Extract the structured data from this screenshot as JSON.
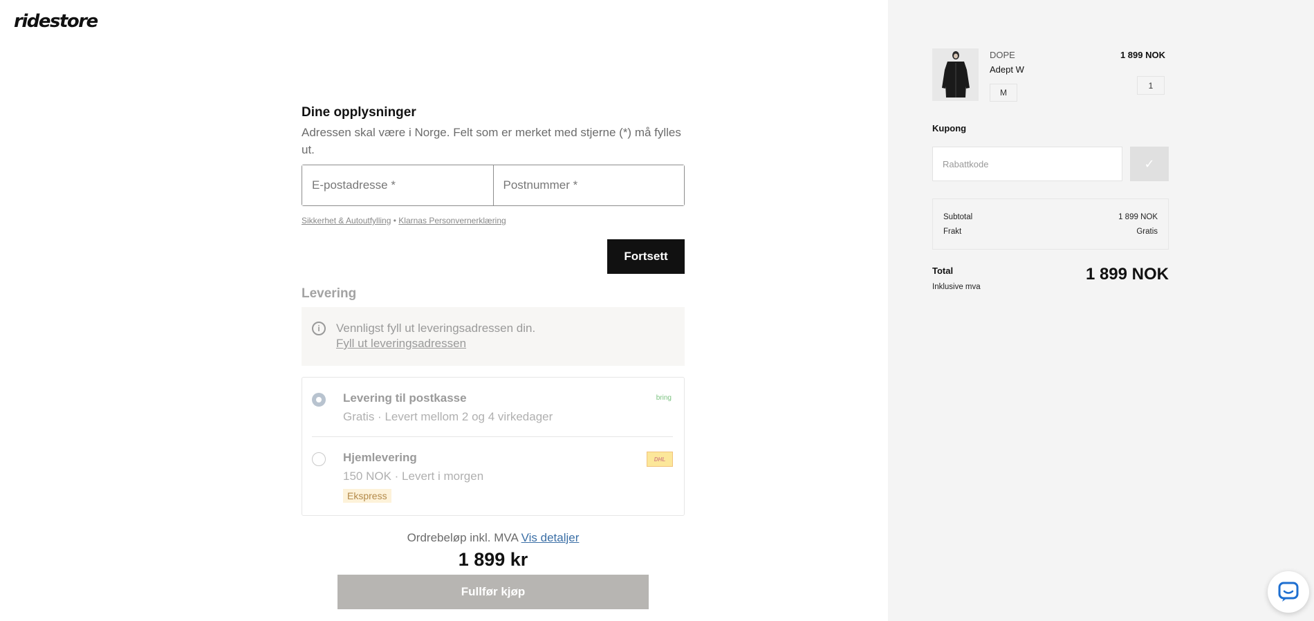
{
  "brand": {
    "logo": "ridestore"
  },
  "contact": {
    "title": "Dine opplysninger",
    "subtitle": "Adressen skal være i Norge. Felt som er merket med stjerne (*) må fylles ut.",
    "email_placeholder": "E-postadresse *",
    "postal_placeholder": "Postnummer *",
    "link_security": "Sikkerhet & Autoutfylling",
    "link_separator": "•",
    "link_privacy": "Klarnas Personvernerklæring",
    "continue_label": "Fortsett"
  },
  "delivery": {
    "title": "Levering",
    "info_text": "Vennligst fyll ut leveringsadressen din.",
    "info_link": "Fyll ut leveringsadressen",
    "options": [
      {
        "name": "Levering til postkasse",
        "desc": "Gratis · Levert mellom 2 og 4 virkedager",
        "carrier": "bring",
        "selected": true
      },
      {
        "name": "Hjemlevering",
        "desc": "150 NOK · Levert i morgen",
        "badge": "Ekspress",
        "carrier": "DHL",
        "selected": false
      }
    ]
  },
  "order": {
    "label": "Ordrebeløp inkl. MVA",
    "details_link": "Vis detaljer",
    "total": "1 899 kr",
    "buy_label": "Fullfør kjøp"
  },
  "cart": {
    "item": {
      "brand": "DOPE",
      "name": "Adept W",
      "size": "M",
      "price": "1 899 NOK",
      "qty": "1"
    },
    "coupon_title": "Kupong",
    "coupon_placeholder": "Rabattkode",
    "subtotal_label": "Subtotal",
    "subtotal_value": "1 899 NOK",
    "shipping_label": "Frakt",
    "shipping_value": "Gratis",
    "total_label": "Total",
    "total_value": "1 899 NOK",
    "vat_note": "Inklusive mva"
  },
  "colors": {
    "accent": "#111111",
    "link": "#3b6fa6",
    "chat": "#1e6fd0",
    "buy_disabled": "#b7b5b2"
  }
}
